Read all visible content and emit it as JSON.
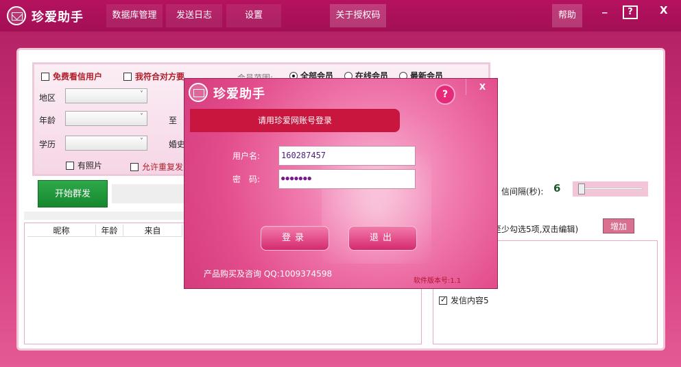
{
  "app": {
    "title": "珍爱助手"
  },
  "menu": {
    "db_manage": "数据库管理",
    "send_log": "发送日志",
    "settings": "设置",
    "auth_code": "关于授权码",
    "help": "帮助"
  },
  "window_controls": {
    "minimize": "_",
    "help": "?",
    "close": "X"
  },
  "filters": {
    "free_user": "免费看信用户",
    "match_requirement": "我符合对方要",
    "member_range_label": "会员范围:",
    "member_options": [
      "全部会员",
      "在线会员",
      "最新会员"
    ],
    "selected_member_option": "全部会员",
    "region_label": "地区",
    "age_label": "年龄",
    "to_label": "至",
    "education_label": "学历",
    "marriage_label": "婚史",
    "has_photo": "有照片",
    "allow_repeat": "允许重复发"
  },
  "actions": {
    "start_send": "开始群发"
  },
  "list": {
    "columns": [
      "昵称",
      "年龄",
      "来自"
    ]
  },
  "settings_panel": {
    "interval_label": "信间隔(秒):",
    "interval_value": "6",
    "hint": "至少勾选5项,双击编辑)",
    "add_button": "增加",
    "content_item": "发信内容5"
  },
  "login_dialog": {
    "title": "珍爱助手",
    "help": "?",
    "close": "X",
    "banner": "请用珍爱网账号登录",
    "username_label": "用户名:",
    "username_value": "160287457",
    "password_label": "密　码:",
    "password_value": "●●●●●●●",
    "login_button": "登录",
    "exit_button": "退出",
    "footer": "产品购买及咨询 QQ:1009374598",
    "version": "软件版本号:1.1"
  }
}
